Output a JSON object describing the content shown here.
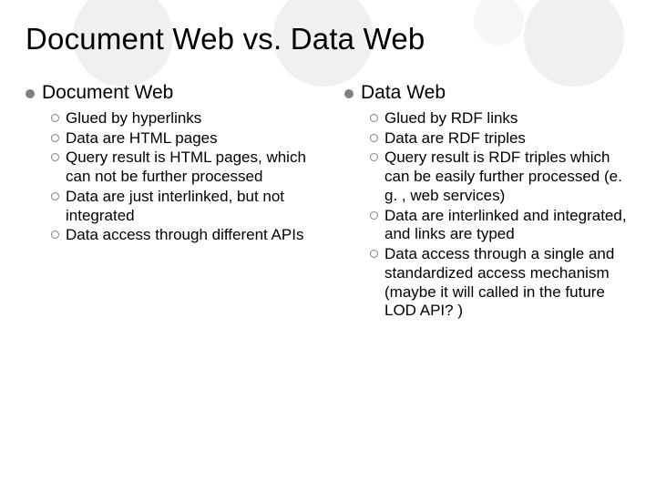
{
  "title": "Document Web vs. Data Web",
  "left": {
    "heading": "Document Web",
    "items": [
      "Glued by hyperlinks",
      "Data are HTML pages",
      "Query result is HTML pages, which can not be further processed",
      "Data are just interlinked, but not integrated",
      "Data access through different APIs"
    ]
  },
  "right": {
    "heading": "Data Web",
    "items": [
      "Glued by RDF links",
      "Data are RDF triples",
      "Query result is RDF triples which can be easily further processed (e. g. , web services)",
      "Data are interlinked and integrated, and links are typed",
      "Data access through a single and standardized access mechanism (maybe it will called in the future LOD API? )"
    ]
  }
}
